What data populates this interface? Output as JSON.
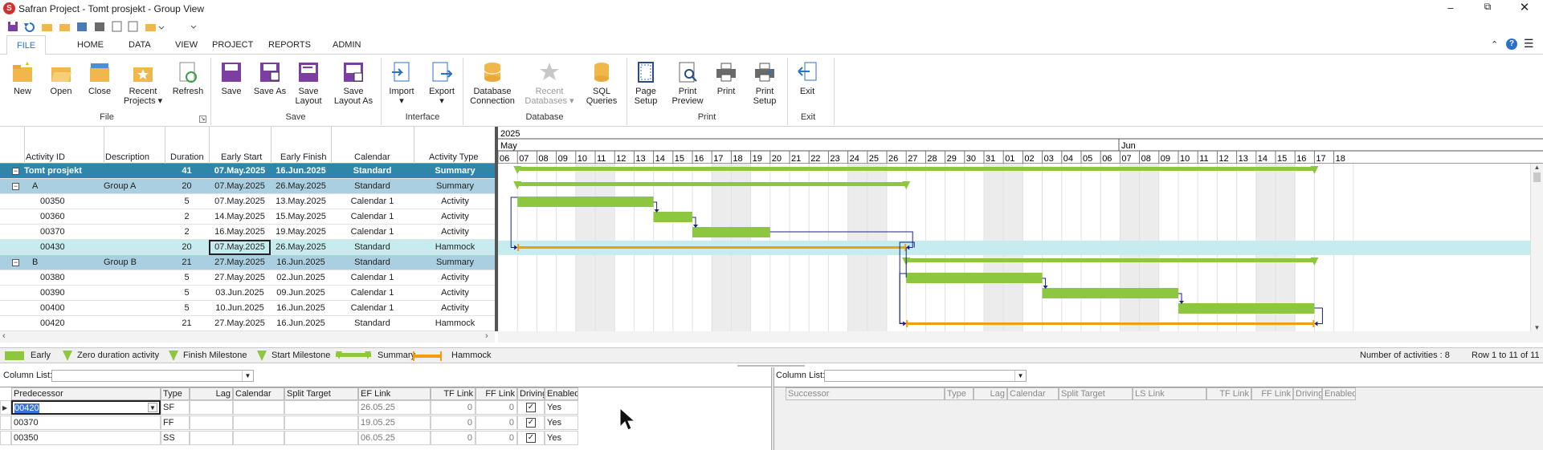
{
  "title": "Safran Project - Tomt prosjekt - Group View",
  "tabs": [
    {
      "label": "FILE",
      "active": true
    },
    {
      "label": "HOME"
    },
    {
      "label": "DATA"
    },
    {
      "label": "VIEW"
    },
    {
      "label": "PROJECT"
    },
    {
      "label": "REPORTS"
    },
    {
      "label": "ADMIN"
    }
  ],
  "ribbon": {
    "buttons": [
      {
        "label": "New",
        "icon": "new-folder-icon"
      },
      {
        "label": "Open",
        "icon": "open-folder-icon"
      },
      {
        "label": "Close",
        "icon": "close-folder-icon"
      },
      {
        "label": "Recent Projects ▾",
        "line1": "Recent",
        "line2": "Projects ▾",
        "icon": "recent-projects-icon"
      },
      {
        "label": "Refresh",
        "icon": "refresh-icon"
      },
      {
        "label": "Save",
        "icon": "save-icon"
      },
      {
        "label": "Save As",
        "icon": "save-as-icon"
      },
      {
        "label": "Save Layout",
        "line1": "Save",
        "line2": "Layout",
        "icon": "save-layout-icon"
      },
      {
        "label": "Save Layout As",
        "line1": "Save",
        "line2": "Layout As",
        "icon": "save-layout-as-icon"
      },
      {
        "label": "Import ▾",
        "line1": "Import",
        "line2": "▾",
        "icon": "import-icon"
      },
      {
        "label": "Export ▾",
        "line1": "Export",
        "line2": "▾",
        "icon": "export-icon"
      },
      {
        "label": "Database Connection",
        "line1": "Database",
        "line2": "Connection",
        "icon": "database-connection-icon"
      },
      {
        "label": "Recent Databases ▾",
        "line1": "Recent",
        "line2": "Databases ▾",
        "icon": "recent-databases-icon"
      },
      {
        "label": "SQL Queries",
        "line1": "SQL",
        "line2": "Queries",
        "icon": "sql-queries-icon"
      },
      {
        "label": "Page Setup",
        "line1": "Page",
        "line2": "Setup",
        "icon": "page-setup-icon"
      },
      {
        "label": "Print Preview",
        "line1": "Print",
        "line2": "Preview",
        "icon": "print-preview-icon"
      },
      {
        "label": "Print",
        "icon": "print-icon"
      },
      {
        "label": "Print Setup",
        "line1": "Print",
        "line2": "Setup",
        "icon": "print-setup-icon"
      },
      {
        "label": "Exit",
        "icon": "exit-icon"
      }
    ],
    "groups": [
      "File",
      "Save",
      "Interface",
      "Database",
      "Print",
      "Exit"
    ]
  },
  "grid": {
    "columns": [
      "Activity ID",
      "Description",
      "Duration",
      "Early Start",
      "Early Finish",
      "Calendar",
      "Activity Type"
    ],
    "rows": [
      {
        "id": "Tomt prosjekt",
        "desc": "",
        "dur": "41",
        "es": "07.May.2025",
        "ef": "16.Jun.2025",
        "cal": "Standard",
        "type": "Summary",
        "kind": "project"
      },
      {
        "id": "A",
        "desc": "Group A",
        "dur": "20",
        "es": "07.May.2025",
        "ef": "26.May.2025",
        "cal": "Standard",
        "type": "Summary",
        "kind": "group"
      },
      {
        "id": "00350",
        "desc": "",
        "dur": "5",
        "es": "07.May.2025",
        "ef": "13.May.2025",
        "cal": "Calendar 1",
        "type": "Activity",
        "kind": "act"
      },
      {
        "id": "00360",
        "desc": "",
        "dur": "2",
        "es": "14.May.2025",
        "ef": "15.May.2025",
        "cal": "Calendar 1",
        "type": "Activity",
        "kind": "act"
      },
      {
        "id": "00370",
        "desc": "",
        "dur": "2",
        "es": "16.May.2025",
        "ef": "19.May.2025",
        "cal": "Calendar 1",
        "type": "Activity",
        "kind": "act"
      },
      {
        "id": "00430",
        "desc": "",
        "dur": "20",
        "es": "07.May.2025",
        "ef": "26.May.2025",
        "cal": "Standard",
        "type": "Hammock",
        "kind": "hammock"
      },
      {
        "id": "B",
        "desc": "Group B",
        "dur": "21",
        "es": "27.May.2025",
        "ef": "16.Jun.2025",
        "cal": "Standard",
        "type": "Summary",
        "kind": "group"
      },
      {
        "id": "00380",
        "desc": "",
        "dur": "5",
        "es": "27.May.2025",
        "ef": "02.Jun.2025",
        "cal": "Calendar 1",
        "type": "Activity",
        "kind": "act"
      },
      {
        "id": "00390",
        "desc": "",
        "dur": "5",
        "es": "03.Jun.2025",
        "ef": "09.Jun.2025",
        "cal": "Calendar 1",
        "type": "Activity",
        "kind": "act"
      },
      {
        "id": "00400",
        "desc": "",
        "dur": "5",
        "es": "10.Jun.2025",
        "ef": "16.Jun.2025",
        "cal": "Calendar 1",
        "type": "Activity",
        "kind": "act"
      },
      {
        "id": "00420",
        "desc": "",
        "dur": "21",
        "es": "27.May.2025",
        "ef": "16.Jun.2025",
        "cal": "Standard",
        "type": "Hammock",
        "kind": "hammock"
      }
    ]
  },
  "timescale": {
    "year": "2025",
    "months": [
      "May",
      "Jun"
    ],
    "days": [
      "06",
      "07",
      "08",
      "09",
      "10",
      "11",
      "12",
      "13",
      "14",
      "15",
      "16",
      "17",
      "18",
      "19",
      "20",
      "21",
      "22",
      "23",
      "24",
      "25",
      "26",
      "27",
      "28",
      "29",
      "30",
      "31",
      "01",
      "02",
      "03",
      "04",
      "05",
      "06",
      "07",
      "08",
      "09",
      "10",
      "11",
      "12",
      "13",
      "14",
      "15",
      "16",
      "17",
      "18"
    ]
  },
  "legend": {
    "items": [
      "Early",
      "Zero duration activity",
      "Finish Milestone",
      "Start Milestone",
      "Summary",
      "Hammock"
    ],
    "count": "Number of activities : 8",
    "rows": "Row 1 to 11 of 11"
  },
  "pred_panel": {
    "column_list_label": "Column List:",
    "headers": [
      "Predecessor",
      "Type",
      "Lag",
      "Calendar",
      "Split Target",
      "EF Link",
      "TF Link",
      "FF Link",
      "Driving",
      "Enabled"
    ],
    "rows": [
      {
        "pred": "00420",
        "type": "SF",
        "ef": "26.05.25",
        "tf": "0",
        "ff": "0",
        "en": "Yes"
      },
      {
        "pred": "00370",
        "type": "FF",
        "ef": "19.05.25",
        "tf": "0",
        "ff": "0",
        "en": "Yes"
      },
      {
        "pred": "00350",
        "type": "SS",
        "ef": "06.05.25",
        "tf": "0",
        "ff": "0",
        "en": "Yes"
      }
    ]
  },
  "succ_panel": {
    "column_list_label": "Column List:",
    "headers": [
      "Successor",
      "Type",
      "Lag",
      "Calendar",
      "Split Target",
      "LS Link",
      "TF Link",
      "FF Link",
      "Driving",
      "Enabled"
    ]
  },
  "colors": {
    "summary": "#8dc63f",
    "hammock": "#f39c12",
    "project_row": "#2e86ab",
    "group_row": "#a9cfe0",
    "selected_row": "#c7ecef",
    "link": "#1a237e"
  }
}
